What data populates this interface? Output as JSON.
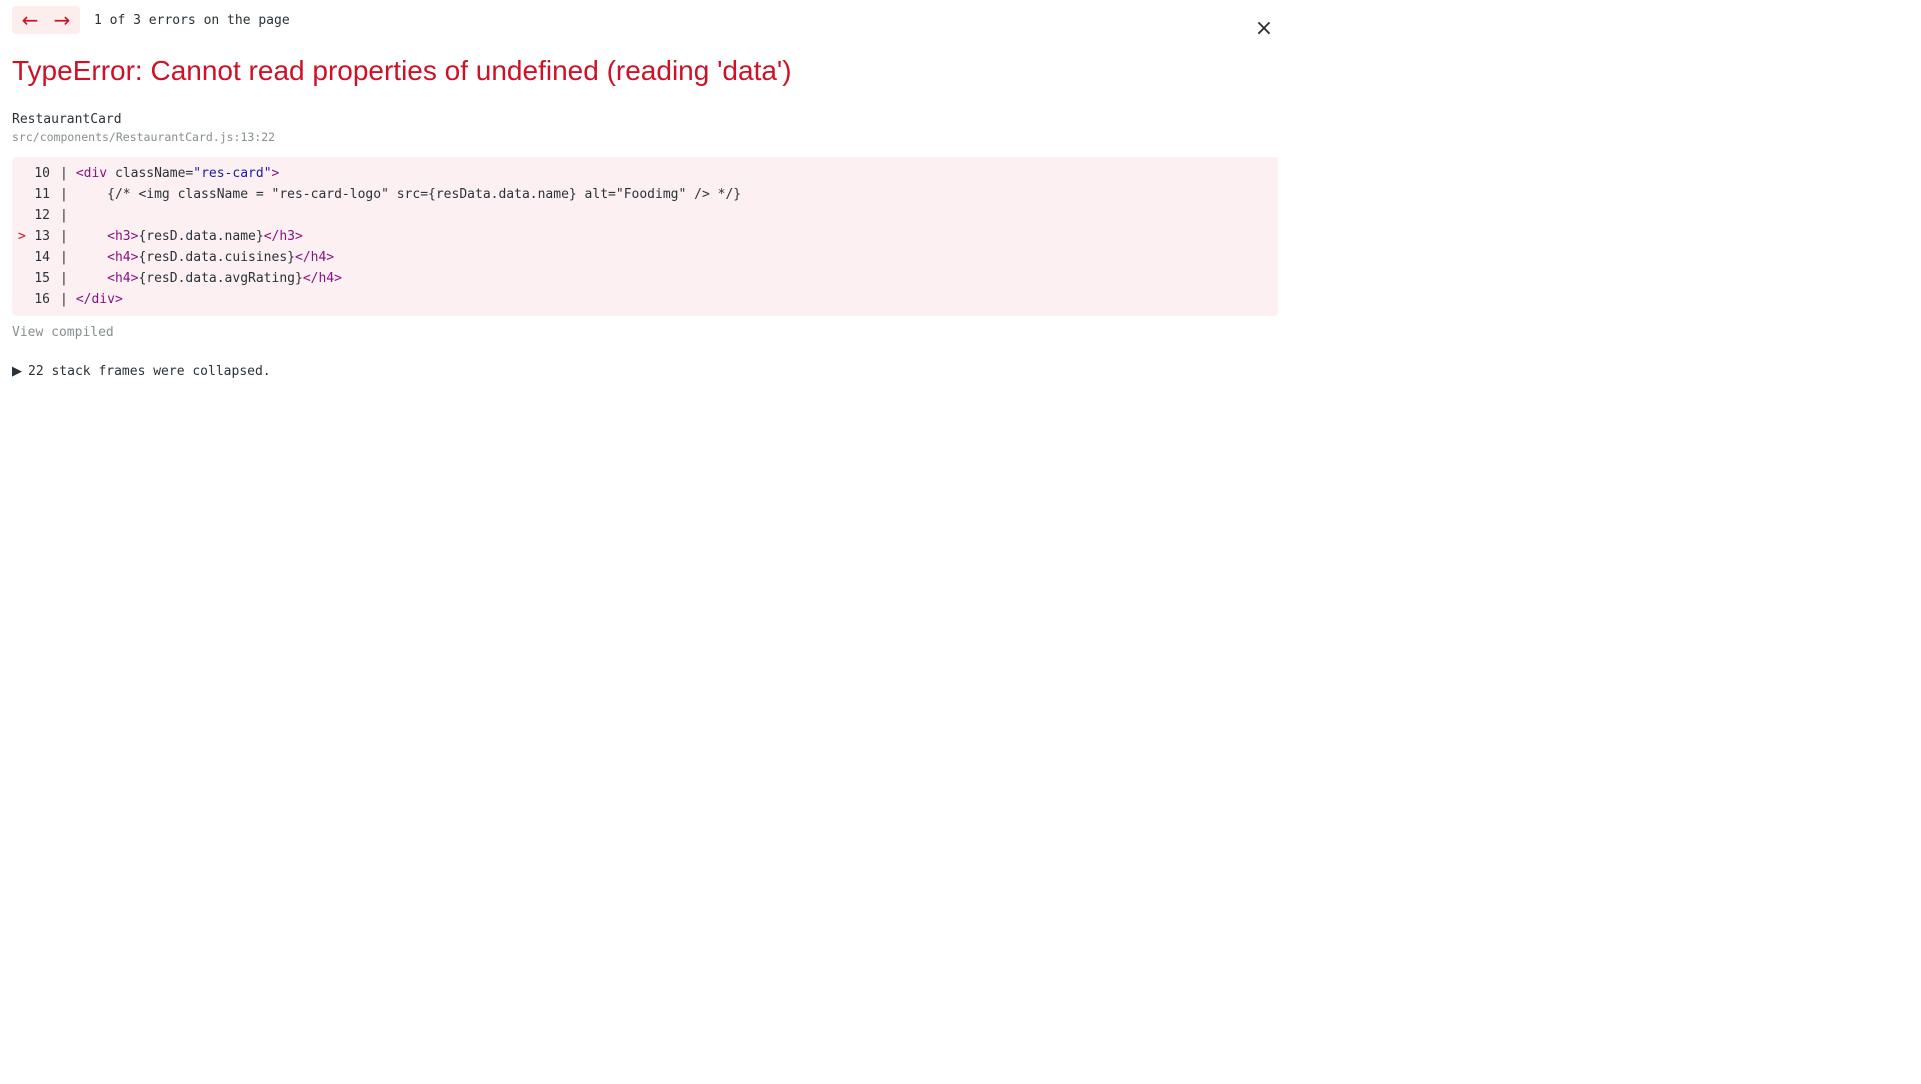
{
  "header": {
    "prev_icon": "←",
    "next_icon": "→",
    "error_count": "1 of 3 errors on the page",
    "close_icon": "×"
  },
  "error": {
    "title": "TypeError: Cannot read properties of undefined (reading 'data')",
    "component": "RestaurantCard",
    "file_path": "src/components/RestaurantCard.js:13:22"
  },
  "code_frame": {
    "lines": [
      {
        "num": "10",
        "marker": "",
        "segments": [
          {
            "cls": "tag",
            "text": "<div "
          },
          {
            "cls": "plain",
            "text": "className="
          },
          {
            "cls": "attr-val",
            "text": "\"res-card\""
          },
          {
            "cls": "tag",
            "text": ">"
          }
        ]
      },
      {
        "num": "11",
        "marker": "",
        "segments": [
          {
            "cls": "comment",
            "text": "    {/* <img className = \"res-card-logo\" src={resData.data.name} alt=\"Foodimg\" /> */}"
          }
        ]
      },
      {
        "num": "12",
        "marker": "",
        "segments": []
      },
      {
        "num": "13",
        "marker": ">",
        "segments": [
          {
            "cls": "plain",
            "text": "    "
          },
          {
            "cls": "tag",
            "text": "<h3>"
          },
          {
            "cls": "plain",
            "text": "{resD.data.name}"
          },
          {
            "cls": "tag",
            "text": "</h3>"
          }
        ]
      },
      {
        "num": "14",
        "marker": "",
        "segments": [
          {
            "cls": "plain",
            "text": "    "
          },
          {
            "cls": "tag",
            "text": "<h4>"
          },
          {
            "cls": "plain",
            "text": "{resD.data.cuisines}"
          },
          {
            "cls": "tag",
            "text": "</h4>"
          }
        ]
      },
      {
        "num": "15",
        "marker": "",
        "segments": [
          {
            "cls": "plain",
            "text": "    "
          },
          {
            "cls": "tag",
            "text": "<h4>"
          },
          {
            "cls": "plain",
            "text": "{resD.data.avgRating}"
          },
          {
            "cls": "tag",
            "text": "</h4>"
          }
        ]
      },
      {
        "num": "16",
        "marker": "",
        "segments": [
          {
            "cls": "tag",
            "text": "</div>"
          }
        ]
      }
    ]
  },
  "footer": {
    "view_compiled": "View compiled",
    "triangle_icon": "▶",
    "stack_frames": "22 stack frames were collapsed."
  },
  "colors": {
    "error_red": "#ce1126",
    "code_bg": "#fcf0f2",
    "muted": "#878e91",
    "tag_purple": "#881280",
    "string_blue": "#1a1aa6"
  }
}
